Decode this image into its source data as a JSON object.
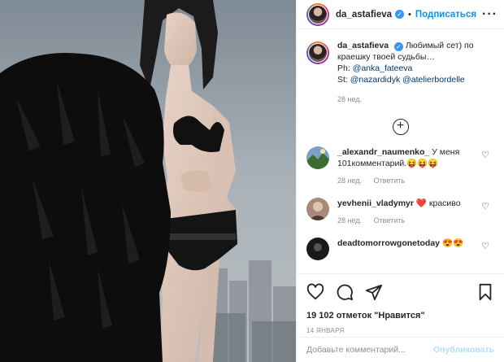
{
  "post": {
    "username": "da_astafieva",
    "follow_label": "Подписаться",
    "more_label": "···",
    "caption": {
      "text": "Любимый сет) по краешку твоей судьбы…",
      "ph_prefix": "Ph:",
      "ph_mention": "@anka_fateeva",
      "st_prefix": "St:",
      "st_mention_1": "@nazardidyk",
      "st_mention_2": "@atelierbordelle",
      "age": "28 нед."
    },
    "comments": [
      {
        "username": "_alexandr_naumenko_",
        "text": "У меня 101комментарий.😝😝😝",
        "age": "28 нед.",
        "reply_label": "Ответить"
      },
      {
        "username": "yevhenii_vladymyr",
        "text": "❤️ красиво",
        "age": "28 нед.",
        "reply_label": "Ответить"
      },
      {
        "username": "deadtomorrowgonetoday",
        "text": "😍😍",
        "age": "",
        "reply_label": ""
      }
    ],
    "likes": "19 102 отметок \"Нравится\"",
    "date": "14 ЯНВАРЯ",
    "add_comment_placeholder": "Добавьте комментарий...",
    "publish_label": "Опубликовать"
  },
  "icons": {
    "verified": "verified-badge-icon",
    "more": "more-options-icon",
    "load_more": "plus-circle-icon",
    "like": "heart-outline-icon",
    "comment": "comment-bubble-icon",
    "share": "paper-plane-icon",
    "save": "bookmark-icon"
  },
  "colors": {
    "link": "#00376b",
    "follow": "#0095f6",
    "publish_disabled": "#b2dffc",
    "muted": "#8e8e8e"
  }
}
